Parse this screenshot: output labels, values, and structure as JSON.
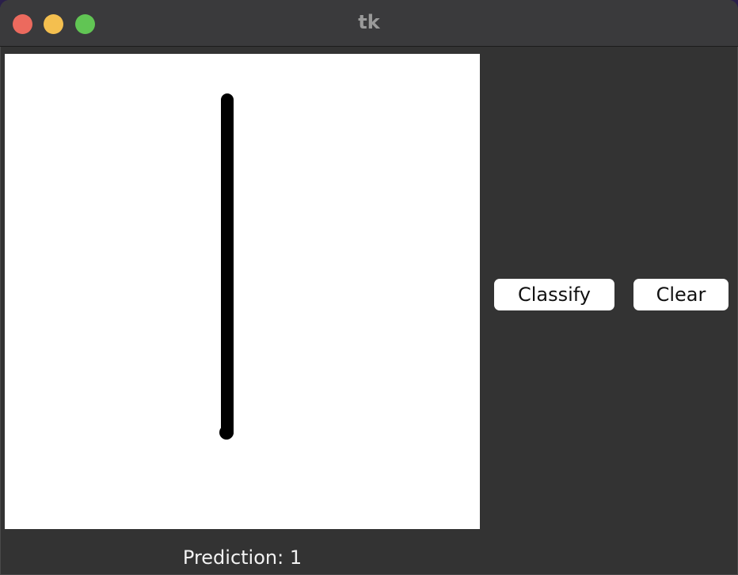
{
  "window": {
    "title": "tk"
  },
  "buttons": {
    "classify_label": "Classify",
    "clear_label": "Clear"
  },
  "prediction": {
    "text": "Prediction: 1"
  },
  "colors": {
    "canvas_background": "#ffffff",
    "stroke": "#000000",
    "window_background": "#333333",
    "button_background": "#ffffff"
  }
}
